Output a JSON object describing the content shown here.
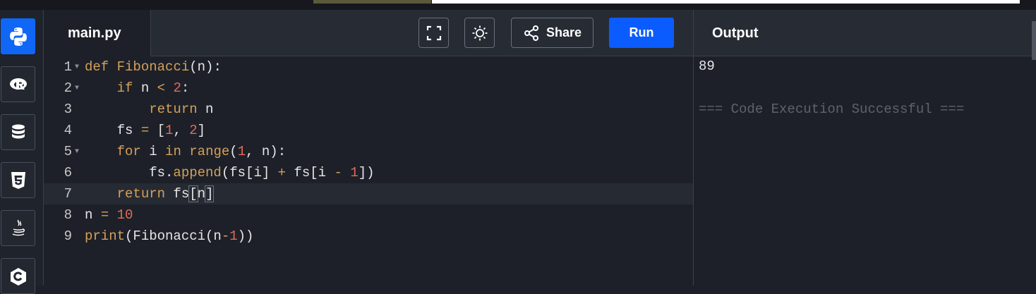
{
  "file_tab": {
    "label": "main.py"
  },
  "toolbar": {
    "share_label": "Share",
    "run_label": "Run",
    "fullscreen_icon": "fullscreen-icon",
    "theme_icon": "sun-icon"
  },
  "output": {
    "title": "Output",
    "lines": [
      "89",
      "=== Code Execution Successful ==="
    ]
  },
  "sidebar": {
    "languages": [
      "python",
      "r",
      "sql",
      "html5",
      "java",
      "c"
    ],
    "active": "python"
  },
  "editor": {
    "line_numbers": [
      "1",
      "2",
      "3",
      "4",
      "5",
      "6",
      "7",
      "8",
      "9"
    ],
    "lines": [
      "def Fibonacci(n):",
      "    if n < 2:",
      "        return n",
      "    fs = [1, 2]",
      "    for i in range(1, n):",
      "        fs.append(fs[i] + fs[i - 1])",
      "    return fs[n]",
      "n = 10",
      "print(Fibonacci(n-1))"
    ],
    "current_line": 7
  },
  "colors": {
    "accent": "#0b5cff",
    "keyword": "#d4a05a",
    "number": "#e06c57",
    "muted": "#5d626d"
  }
}
